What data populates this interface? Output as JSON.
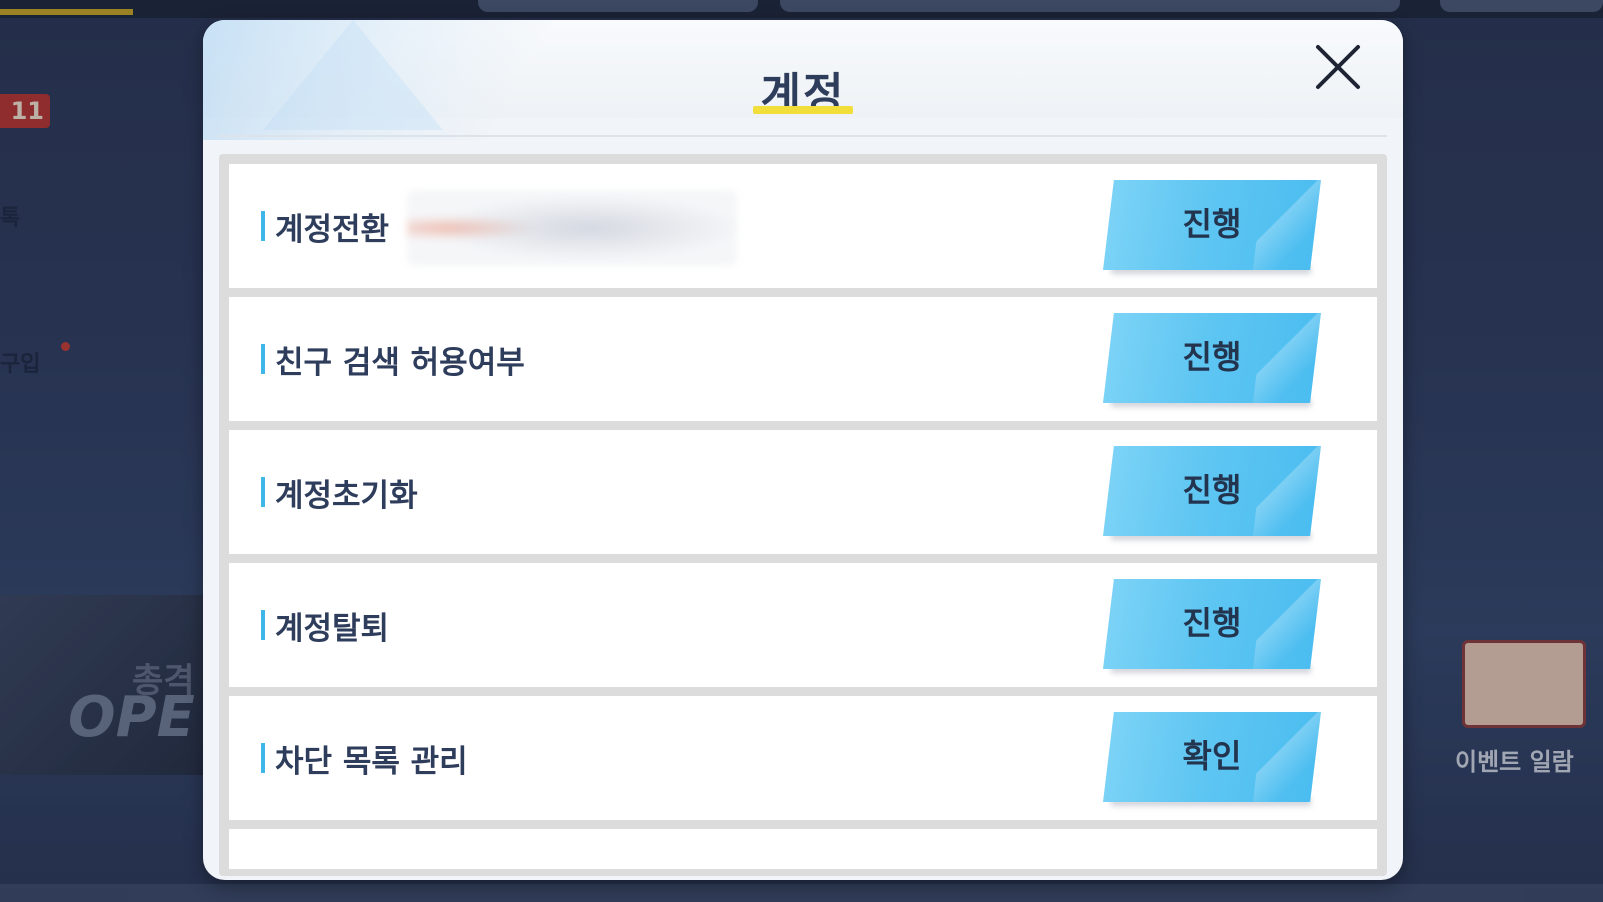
{
  "background": {
    "left_texts": [
      "톡",
      "구입"
    ],
    "banner_texts": [
      "총격",
      "OPE"
    ],
    "event_label": "이벤트 일람",
    "badge_number": "11"
  },
  "modal": {
    "title": "계정",
    "close_icon": "close-icon",
    "rows": [
      {
        "label": "계정전환",
        "button": "진행",
        "has_blurred_account": true
      },
      {
        "label": "친구 검색 허용여부",
        "button": "진행"
      },
      {
        "label": "계정초기화",
        "button": "진행"
      },
      {
        "label": "계정탈퇴",
        "button": "진행"
      },
      {
        "label": "차단 목록 관리",
        "button": "확인"
      }
    ]
  },
  "colors": {
    "accent_blue": "#49bcf0",
    "title_underline": "#f2de3a",
    "text_dark": "#2f3d5c"
  }
}
